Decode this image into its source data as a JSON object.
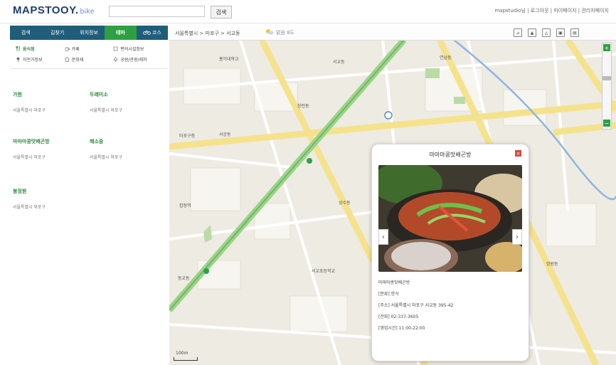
{
  "header": {
    "logo_main": "MAPSTOOY.",
    "logo_sub": "bike",
    "search_value": "",
    "search_button": "검색",
    "top_links": "mapstudio님 | 로그아웃 | 마이페이지 | 관리자페이지"
  },
  "sidebar": {
    "tabs": [
      "검색",
      "길찾기",
      "위치정보",
      "테마",
      "코스"
    ],
    "active_tab": 3,
    "categories": [
      {
        "label": "음식점",
        "icon": "restaurant-icon",
        "active": true
      },
      {
        "label": "카페",
        "icon": "cafe-icon",
        "active": false
      },
      {
        "label": "편의시설정보",
        "icon": "facility-icon",
        "active": false
      },
      {
        "label": "자전거정보",
        "icon": "bike-info-icon",
        "active": false
      },
      {
        "label": "문화재",
        "icon": "heritage-icon",
        "active": false
      },
      {
        "label": "공원/관광/레저",
        "icon": "park-icon",
        "active": false
      }
    ],
    "results": [
      {
        "name": "가원",
        "address": "서울특별시 마포구"
      },
      {
        "name": "두레미소",
        "address": "서울특별시 마포구"
      },
      {
        "name": "마마마콩맛배곤방",
        "address": "서울특별시 마포구"
      },
      {
        "name": "해소중",
        "address": "서울특별시 마포구"
      },
      {
        "name": "봉정원",
        "address": "서울특별시 마포구"
      }
    ]
  },
  "map": {
    "breadcrumb": "서울특별시 > 마포구 > 서교동",
    "weather": "맑음 8도",
    "labels": [
      "서교동",
      "홍익대학교",
      "마포구청",
      "합정역",
      "상수동",
      "서교초등학교",
      "동교동",
      "연남동",
      "망원동",
      "창전동",
      "서강동"
    ],
    "scale": "100m"
  },
  "popup": {
    "title": "마마마콩맛배곤방",
    "info": [
      "마마마콩맛배곤방",
      "[분류] 한식",
      "[주소] 서울특별시 마포구 서교동 395-42",
      "[전화] 02-337-3605",
      "[영업시간] 11:00-22:00"
    ]
  },
  "colors": {
    "tab_bar": "#1f5d7a",
    "accent": "#2ea043",
    "close": "#d9473f"
  }
}
